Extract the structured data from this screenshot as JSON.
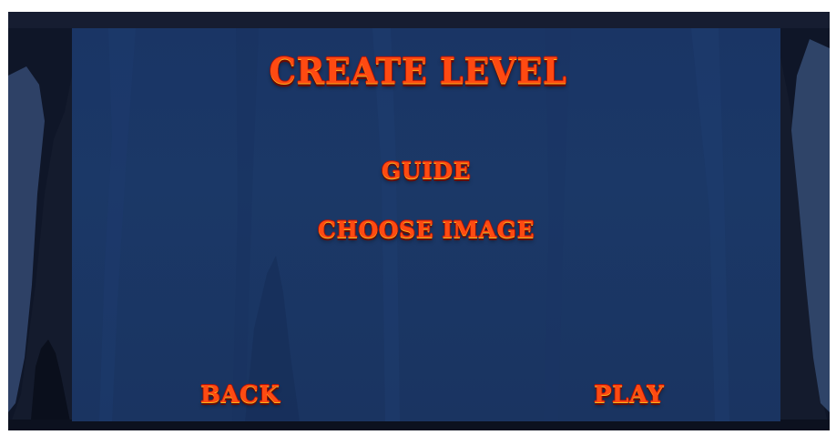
{
  "screen": {
    "title": "CREATE LEVEL"
  },
  "menu": {
    "guide_label": "GUIDE",
    "choose_image_label": "CHOOSE IMAGE"
  },
  "navigation": {
    "back_label": "BACK",
    "play_label": "PLAY"
  },
  "colors": {
    "text_fill": "#ff4a12",
    "text_highlight": "#ffb21a",
    "text_outline": "#a51005",
    "panel_background": "#1a3565",
    "frame_background": "#141b2d"
  }
}
